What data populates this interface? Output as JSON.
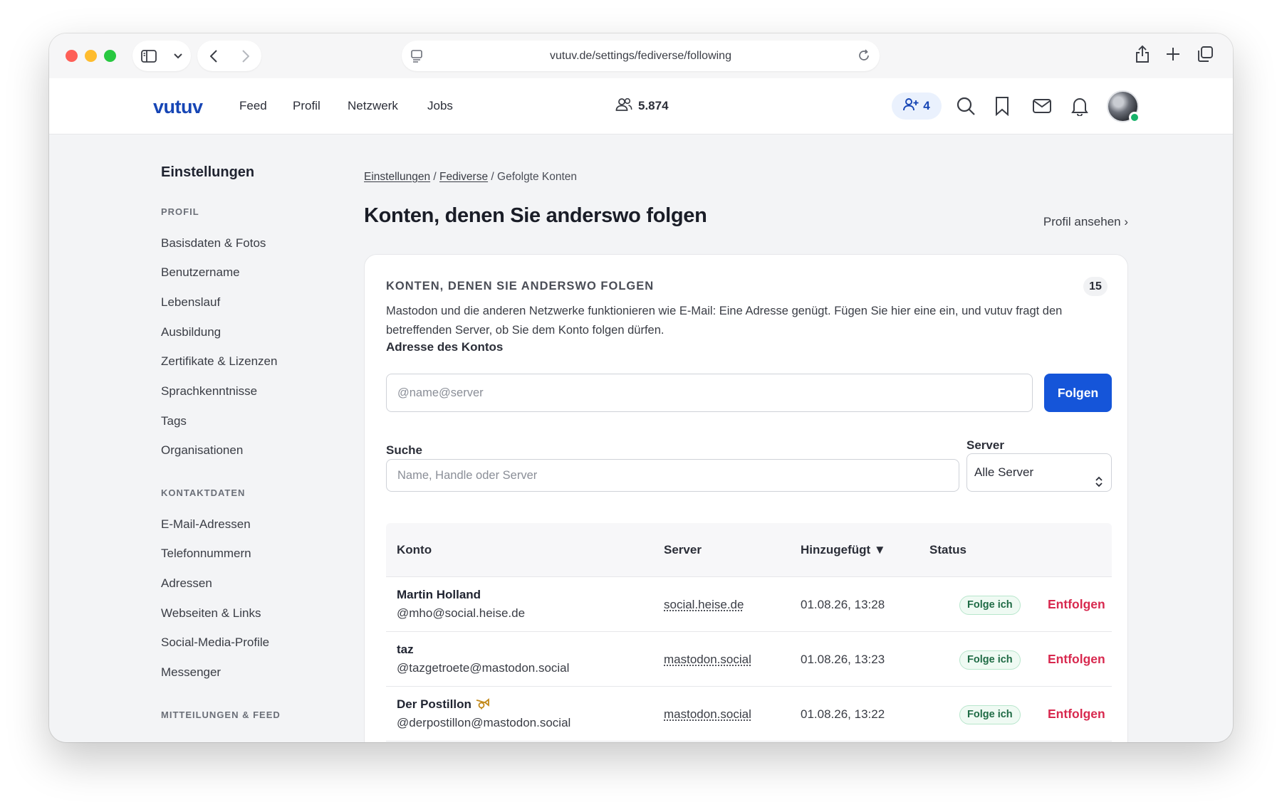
{
  "browser": {
    "url": "vutuv.de/settings/fediverse/following"
  },
  "header": {
    "logo": "vutuv",
    "nav": [
      "Feed",
      "Profil",
      "Netzwerk",
      "Jobs"
    ],
    "member_count": "5.874",
    "requests_count": "4",
    "accent_color": "#1746b5"
  },
  "sidebar": {
    "title": "Einstellungen",
    "sections": [
      {
        "label": "PROFIL",
        "items": [
          "Basisdaten & Fotos",
          "Benutzername",
          "Lebenslauf",
          "Ausbildung",
          "Zertifikate & Lizenzen",
          "Sprachkenntnisse",
          "Tags",
          "Organisationen"
        ]
      },
      {
        "label": "KONTAKTDATEN",
        "items": [
          "E-Mail-Adressen",
          "Telefonnummern",
          "Adressen",
          "Webseiten & Links",
          "Social-Media-Profile",
          "Messenger"
        ]
      },
      {
        "label": "MITTEILUNGEN & FEED",
        "items": []
      }
    ]
  },
  "breadcrumb": {
    "items": [
      "Einstellungen",
      "Fediverse"
    ],
    "current": "Gefolgte Konten"
  },
  "page": {
    "title": "Konten, denen Sie anderswo folgen",
    "view_profile": "Profil ansehen ›"
  },
  "card": {
    "heading": "KONTEN, DENEN SIE ANDERSWO FOLGEN",
    "count": "15",
    "description": "Mastodon und die anderen Netzwerke funktionieren wie E-Mail: Eine Adresse genügt. Fügen Sie hier eine ein, und vutuv fragt den betreffenden Server, ob Sie dem Konto folgen dürfen.",
    "address_label": "Adresse des Kontos",
    "address_placeholder": "@name@server",
    "follow_button": "Folgen",
    "search_label": "Suche",
    "search_placeholder": "Name, Handle oder Server",
    "server_label": "Server",
    "server_selected": "Alle Server"
  },
  "table": {
    "columns": [
      "Konto",
      "Server",
      "Hinzugefügt ▼",
      "Status"
    ],
    "rows": [
      {
        "name": "Martin Holland",
        "handle": "@mho@social.heise.de",
        "server": "social.heise.de",
        "added": "01.08.26, 13:28",
        "status": "Folge ich",
        "action": "Entfolgen"
      },
      {
        "name": "taz",
        "handle": "@tazgetroete@mastodon.social",
        "server": "mastodon.social",
        "added": "01.08.26, 13:23",
        "status": "Folge ich",
        "action": "Entfolgen"
      },
      {
        "name": "Der Postillon",
        "handle": "@derpostillon@mastodon.social",
        "server": "mastodon.social",
        "added": "01.08.26, 13:22",
        "status": "Folge ich",
        "action": "Entfolgen"
      }
    ]
  },
  "colors": {
    "primary_button": "#1555d9",
    "danger": "#d8294f",
    "status_green": "#1f6b45"
  }
}
